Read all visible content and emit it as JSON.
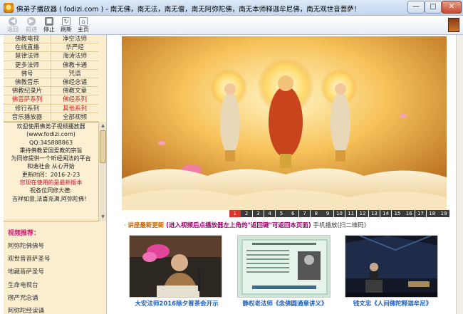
{
  "window": {
    "title": "佛弟子播放器 ( fodizi.com ) - 南无佛，南无法，南无僧，南无阿弥陀佛，南无本师释迦牟尼佛，南无观世音菩萨！",
    "min": "—",
    "max": "□",
    "close": "✕"
  },
  "toolbar": {
    "back": "返回",
    "forward": "前进",
    "stop": "停止",
    "refresh": "刷新",
    "home": "主页",
    "back_glyph": "◀",
    "forward_glyph": "▶",
    "stop_glyph": "■",
    "refresh_glyph": "↻",
    "home_glyph": "⌂"
  },
  "menu": [
    [
      "佛教电视",
      "净空法师"
    ],
    [
      "在线直播",
      "华严经"
    ],
    [
      "慧律法师",
      "海涛法师"
    ],
    [
      "更多法师",
      "佛教卡通"
    ],
    [
      "佛号",
      "咒语"
    ],
    [
      "佛教音乐",
      "佛经念诵"
    ],
    [
      "佛教纪录片",
      "佛教文章"
    ],
    [
      "佛菩萨系列",
      "佛经系列"
    ],
    [
      "修行系列",
      "其他系列"
    ],
    [
      "音乐播放器",
      "全部视频"
    ]
  ],
  "welcome": {
    "l1": "欢迎使用佛弟子视频播放器",
    "l2": "(www.fodizi.com)",
    "l3": "QQ:345888863",
    "l4": "秉持佛教爱国爱教的宗旨",
    "l5": "为同修提供一个听经闻法的平台",
    "l6": "和谐社会 从心开始",
    "l7": "更新时间：2016-2-23",
    "l8": "您现在使用的是最新版本",
    "l9": "祝各位同修大德:",
    "l10": "吉祥如意,法喜充满,阿弥陀佛！"
  },
  "scroll": {
    "up": "▲",
    "down": "▼"
  },
  "recommend": {
    "title": "视频推荐：",
    "items": [
      "阿弥陀佛佛号",
      "观世音菩萨圣号",
      "地藏菩萨圣号",
      "生命电视台",
      "楞严咒念诵",
      "阿弥陀经读诵"
    ]
  },
  "pager": [
    "1",
    "2",
    "3",
    "4",
    "5",
    "6",
    "7",
    "8",
    "9",
    "10",
    "11",
    "12",
    "13",
    "14",
    "15",
    "16",
    "17",
    "18",
    "19"
  ],
  "pager_active": "1",
  "update": {
    "dot": "·",
    "lead": "讲座最新更新",
    "hint": "(进入视频后点播放器左上角的\"返回键\"可返回本页面)",
    "mobile": "手机播放(扫二维码)"
  },
  "videos": [
    {
      "caption": "大安法师2016除夕普茶会开示"
    },
    {
      "caption": "静权老法师《念佛圆通章讲义》"
    },
    {
      "caption": "钱文忠《人间佛陀释迦牟尼》"
    }
  ],
  "colors": {
    "accent_red": "#d7362a",
    "panel_bg": "#fbeecf",
    "link_blue": "#1d5fbf"
  }
}
